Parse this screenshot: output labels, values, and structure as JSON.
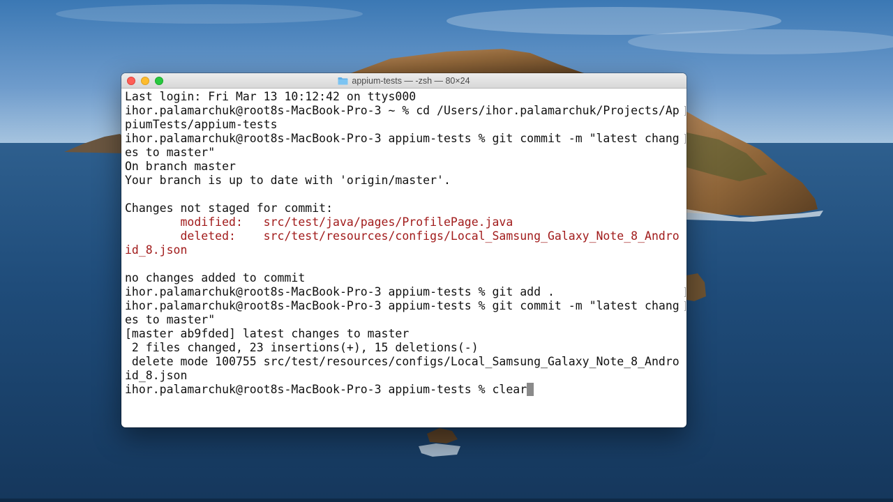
{
  "window": {
    "title": "appium-tests — -zsh — 80×24",
    "folder_icon": "folder-icon"
  },
  "terminal": {
    "lines": [
      {
        "text": "Last login: Fri Mar 13 10:12:42 on ttys000",
        "color": "default",
        "marker": false,
        "wrapped": false
      },
      {
        "text": "ihor.palamarchuk@root8s-MacBook-Pro-3 ~ % cd /Users/ihor.palamarchuk/Projects/Ap",
        "color": "default",
        "marker": true,
        "wrapped": true
      },
      {
        "text": "piumTests/appium-tests",
        "color": "default",
        "marker": false,
        "wrapped": false
      },
      {
        "text": "ihor.palamarchuk@root8s-MacBook-Pro-3 appium-tests % git commit -m \"latest chang",
        "color": "default",
        "marker": true,
        "wrapped": true
      },
      {
        "text": "es to master\"",
        "color": "default",
        "marker": false,
        "wrapped": false
      },
      {
        "text": "On branch master",
        "color": "default",
        "marker": false,
        "wrapped": false
      },
      {
        "text": "Your branch is up to date with 'origin/master'.",
        "color": "default",
        "marker": false,
        "wrapped": false
      },
      {
        "text": "",
        "color": "default",
        "marker": false,
        "wrapped": false
      },
      {
        "text": "Changes not staged for commit:",
        "color": "default",
        "marker": false,
        "wrapped": false
      },
      {
        "text": "        modified:   src/test/java/pages/ProfilePage.java",
        "color": "red",
        "marker": false,
        "wrapped": false
      },
      {
        "text": "        deleted:    src/test/resources/configs/Local_Samsung_Galaxy_Note_8_Andro",
        "color": "red",
        "marker": false,
        "wrapped": false
      },
      {
        "text": "id_8.json",
        "color": "red",
        "marker": false,
        "wrapped": false
      },
      {
        "text": "",
        "color": "default",
        "marker": false,
        "wrapped": false
      },
      {
        "text": "no changes added to commit",
        "color": "default",
        "marker": false,
        "wrapped": false
      },
      {
        "text": "ihor.palamarchuk@root8s-MacBook-Pro-3 appium-tests % git add .",
        "color": "default",
        "marker": true,
        "wrapped": true
      },
      {
        "text": "ihor.palamarchuk@root8s-MacBook-Pro-3 appium-tests % git commit -m \"latest chang",
        "color": "default",
        "marker": true,
        "wrapped": true
      },
      {
        "text": "es to master\"",
        "color": "default",
        "marker": false,
        "wrapped": false
      },
      {
        "text": "[master ab9fded] latest changes to master",
        "color": "default",
        "marker": false,
        "wrapped": false
      },
      {
        "text": " 2 files changed, 23 insertions(+), 15 deletions(-)",
        "color": "default",
        "marker": false,
        "wrapped": false
      },
      {
        "text": " delete mode 100755 src/test/resources/configs/Local_Samsung_Galaxy_Note_8_Andro",
        "color": "default",
        "marker": false,
        "wrapped": false
      },
      {
        "text": "id_8.json",
        "color": "default",
        "marker": false,
        "wrapped": false
      },
      {
        "text": "ihor.palamarchuk@root8s-MacBook-Pro-3 appium-tests % clear",
        "color": "default",
        "marker": false,
        "wrapped": false,
        "cursor": true
      }
    ],
    "colors": {
      "text": "#111111",
      "diff_red": "#a11b1b",
      "cursor": "#8a8a8a",
      "background": "#ffffff"
    }
  },
  "desktop": {
    "wallpaper": "macOS Catalina island",
    "colors": {
      "sky_top": "#2f6ea8",
      "sea": "#1b4a78"
    }
  }
}
